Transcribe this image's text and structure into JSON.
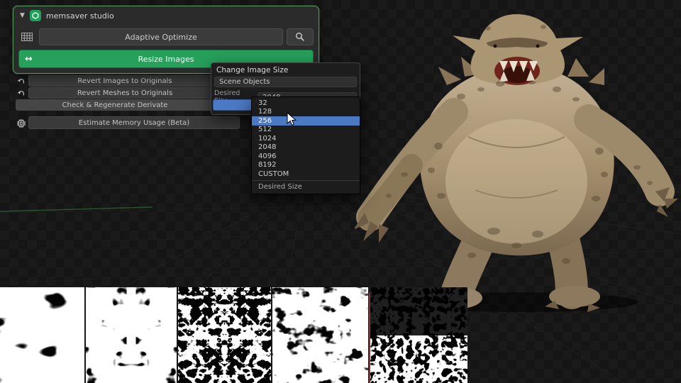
{
  "panel": {
    "title": "memsaver studio",
    "buttons": {
      "adaptive_optimize": "Adaptive Optimize",
      "resize_images": "Resize Images",
      "revert_images": "Revert Images to Originals",
      "revert_meshes": "Revert Meshes to Originals",
      "check_regenerate": "Check & Regenerate Derivate",
      "estimate_memory": "Estimate Memory Usage (Beta)"
    }
  },
  "dialog": {
    "title": "Change Image Size",
    "scene_objects": "Scene Objects",
    "desired_size_label": "Desired Size:",
    "desired_size_value": "2048",
    "menu": {
      "options": [
        "32",
        "128",
        "256",
        "512",
        "1024",
        "2048",
        "4096",
        "8192",
        "CUSTOM"
      ],
      "selected": "256",
      "footer": "Desired Size"
    }
  },
  "colors": {
    "accent_green": "#26a05b",
    "selection_blue": "#4b79c4",
    "panel_outline": "#55975c"
  }
}
